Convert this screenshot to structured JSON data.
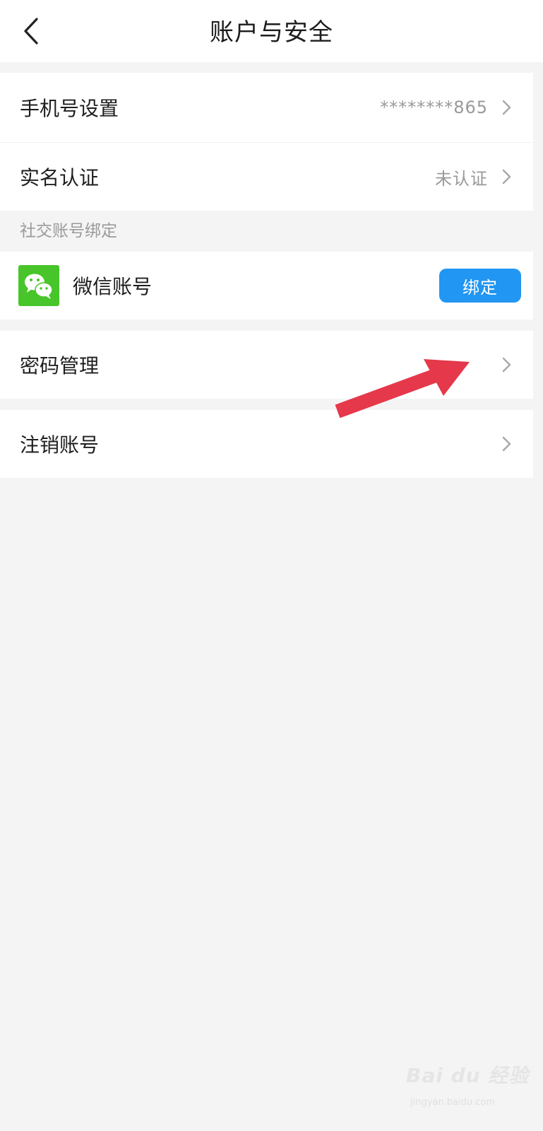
{
  "header": {
    "title": "账户与安全",
    "back_icon": "chevron-left-icon"
  },
  "rows": {
    "phone": {
      "label": "手机号设置",
      "value": "********865"
    },
    "realname": {
      "label": "实名认证",
      "value": "未认证"
    },
    "password": {
      "label": "密码管理"
    },
    "delete": {
      "label": "注销账号"
    }
  },
  "social": {
    "section_label": "社交账号绑定",
    "wechat": {
      "label": "微信账号",
      "icon": "wechat-icon",
      "bind_label": "绑定",
      "icon_color": "#48c52a",
      "button_color": "#2196f3"
    }
  },
  "annotation": {
    "arrow_color": "#e5384a",
    "arrow_icon": "red-arrow-pointer"
  },
  "watermark": {
    "brand": "Bai du 经验",
    "url": "jingyan.baidu.com"
  }
}
